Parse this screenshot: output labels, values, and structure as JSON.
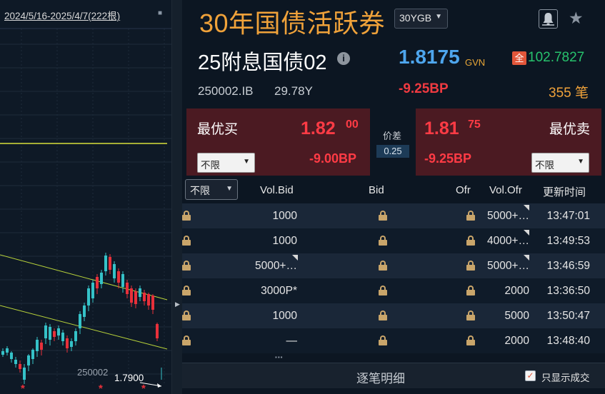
{
  "chart": {
    "range_label": "2024/5/16-2025/4/7(222根)",
    "settings_icon": "gear-icon",
    "series_label": "250002",
    "last_price": "1.7900",
    "marker_symbol": "*"
  },
  "header": {
    "title": "30年国债活跃券",
    "code_select": "30YGB",
    "bell_icon": "bell-icon",
    "favorite_icon": "star-icon"
  },
  "bond": {
    "name": "25附息国债02",
    "info_icon": "info-icon",
    "yield": "1.8175",
    "yield_unit": "GVN",
    "full_badge": "全",
    "full_price": "102.7827",
    "code": "250002.IB",
    "term": "29.78Y",
    "change_bp": "-9.25BP",
    "deal_count": "355",
    "deal_unit": "笔"
  },
  "best_bid": {
    "label": "最优买",
    "price_main": "1.82",
    "price_sup": "00",
    "bp": "-9.00BP",
    "select": "不限"
  },
  "best_ask": {
    "label": "最优卖",
    "price_main": "1.81",
    "price_sup": "75",
    "bp": "-9.25BP",
    "select": "不限"
  },
  "spread": {
    "label": "价差",
    "value": "0.25"
  },
  "table": {
    "filter": "不限",
    "headers": {
      "vol_bid": "Vol.Bid",
      "bid": "Bid",
      "ofr": "Ofr",
      "vol_ofr": "Vol.Ofr",
      "time": "更新时间"
    },
    "rows": [
      {
        "vol_bid": "1000",
        "vol_ofr": "5000+…",
        "time": "13:47:01"
      },
      {
        "vol_bid": "1000",
        "vol_ofr": "4000+…",
        "time": "13:49:53"
      },
      {
        "vol_bid": "5000+…",
        "vol_ofr": "5000+…",
        "time": "13:46:59"
      },
      {
        "vol_bid": "3000P*",
        "vol_ofr": "2000",
        "time": "13:36:50"
      },
      {
        "vol_bid": "1000",
        "vol_ofr": "5000",
        "time": "13:50:47"
      },
      {
        "vol_bid": "—",
        "vol_ofr": "2000",
        "time": "13:48:40"
      }
    ]
  },
  "footer": {
    "title": "逐笔明细",
    "checkbox_label": "只显示成交",
    "checkbox_mark": "✓"
  },
  "colors": {
    "accent_orange": "#f0a23a",
    "yield_blue": "#4ea6ee",
    "down_red": "#ef3a41",
    "up_green": "#27c36d",
    "quote_bg": "#4b1a22"
  }
}
